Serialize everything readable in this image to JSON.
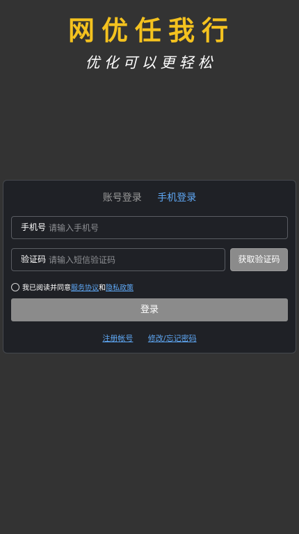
{
  "brand": {
    "title": "网优任我行",
    "slogan": "优化可以更轻松"
  },
  "login": {
    "tabs": [
      {
        "label": "账号登录",
        "active": false
      },
      {
        "label": "手机登录",
        "active": true
      }
    ],
    "phone_field": {
      "label": "手机号",
      "value": "",
      "placeholder": "请输入手机号"
    },
    "code_field": {
      "label": "验证码",
      "value": "",
      "placeholder": "请输入短信验证码"
    },
    "get_code_button": "获取验证码",
    "agreement": {
      "checked": false,
      "prefix": "我已阅读并同意",
      "service_link": "服务协议",
      "conjunction": "和",
      "privacy_link": "隐私政策"
    },
    "submit_button": "登录",
    "register_link": "注册帐号",
    "reset_link": "修改/忘记密码"
  },
  "colors": {
    "page_bg": "#333333",
    "card_bg": "#1f2126",
    "brand_yellow": "#f4c21f",
    "link_blue": "#5fa8f5",
    "button_gray": "#8b8b8b"
  }
}
